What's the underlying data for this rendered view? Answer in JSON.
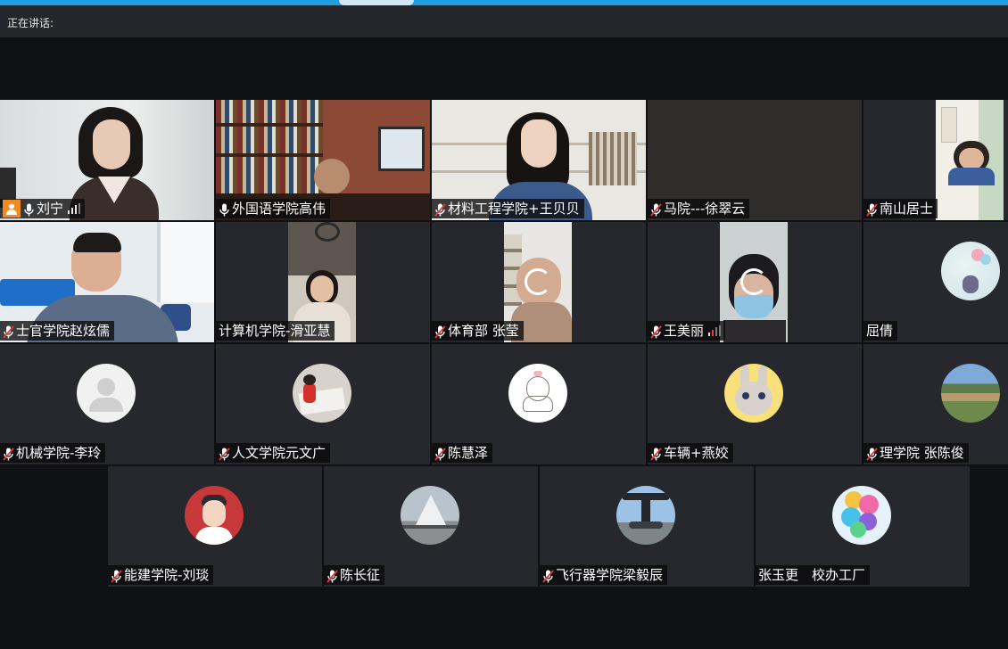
{
  "header": {
    "speaking_label": "正在讲话:"
  },
  "colors": {
    "accent": "#1f9fe0",
    "host_badge": "#f08a24",
    "tile_bg": "#26282d"
  },
  "participants": [
    {
      "name": "刘宁",
      "mic": "on",
      "host": true,
      "signal": true
    },
    {
      "name": "外国语学院高伟",
      "mic": "on"
    },
    {
      "name": "材料工程学院+王贝贝",
      "mic": "muted"
    },
    {
      "name": "马院---徐翠云",
      "mic": "muted"
    },
    {
      "name": "南山居士",
      "mic": "muted"
    },
    {
      "name": "士官学院赵炫儒",
      "mic": "muted"
    },
    {
      "name": "计算机学院-滑亚慧",
      "mic": "none"
    },
    {
      "name": "体育部 张莹",
      "mic": "muted"
    },
    {
      "name": "王美丽",
      "mic": "muted",
      "signal": true
    },
    {
      "name": "屈倩",
      "mic": "none"
    },
    {
      "name": "机械学院-李玲",
      "mic": "muted"
    },
    {
      "name": "人文学院元文广",
      "mic": "muted"
    },
    {
      "name": "陈慧泽",
      "mic": "muted"
    },
    {
      "name": "车辆+燕姣",
      "mic": "muted"
    },
    {
      "name": "理学院 张陈俊",
      "mic": "muted"
    },
    {
      "name": "能建学院-刘琰",
      "mic": "muted"
    },
    {
      "name": "陈长征",
      "mic": "muted"
    },
    {
      "name": "飞行器学院梁毅辰",
      "mic": "muted"
    },
    {
      "name": "张玉更　校办工厂",
      "mic": "none"
    }
  ]
}
